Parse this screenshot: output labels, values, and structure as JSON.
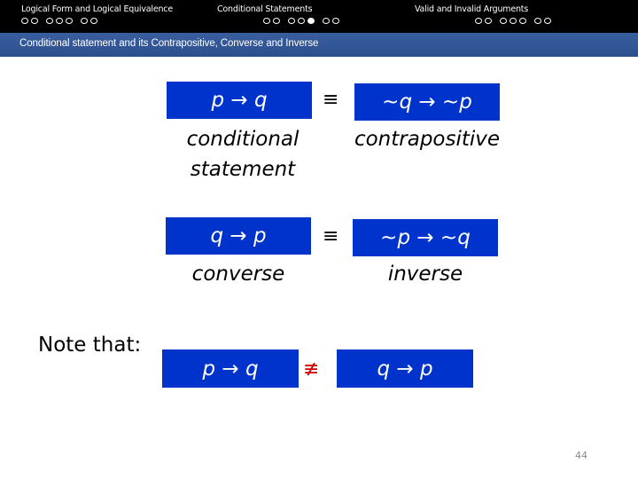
{
  "nav": {
    "sections": [
      {
        "title": "Logical Form and Logical Equivalence",
        "groups": [
          [
            false,
            false
          ],
          [
            false,
            false,
            false
          ],
          [
            false,
            false
          ]
        ]
      },
      {
        "title": "Conditional Statements",
        "groups": [
          [
            false,
            false
          ],
          [
            false,
            false,
            true
          ],
          [
            false,
            false
          ]
        ]
      },
      {
        "title": "Valid and Invalid Arguments",
        "groups": [
          [
            false,
            false
          ],
          [
            false,
            false,
            false
          ],
          [
            false,
            false
          ]
        ]
      }
    ]
  },
  "slide": {
    "title": "Conditional statement and its Contrapositive, Converse and Inverse",
    "row1": {
      "left": "p → q",
      "relation": "≡",
      "right": "~q → ~p",
      "left_label": "conditional statement",
      "right_label": "contrapositive"
    },
    "row2": {
      "left": "q → p",
      "relation": "≡",
      "right": "~p → ~q",
      "left_label": "converse",
      "right_label": "inverse"
    },
    "note": {
      "label": "Note that:",
      "left": "p → q",
      "relation": "≢",
      "right": "q → p"
    },
    "page_number": "44"
  },
  "colors": {
    "box": "#0033cc",
    "not_equiv": "#cc0000",
    "header": "#000000",
    "subheader": "#2c4f8c"
  }
}
